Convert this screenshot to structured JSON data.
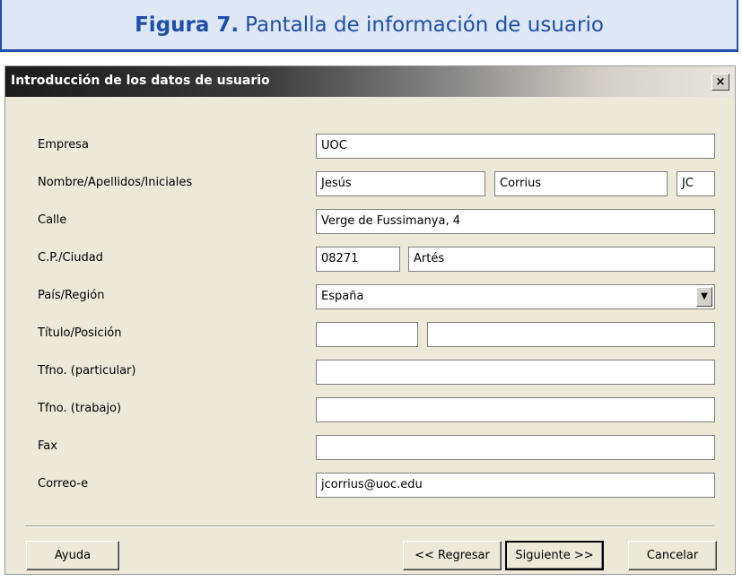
{
  "caption": {
    "number": "Figura 7.",
    "text": "Pantalla de información de usuario"
  },
  "dialog": {
    "title": "Introducción de los datos de usuario",
    "close_icon": "close-icon",
    "fields": {
      "empresa": {
        "label": "Empresa",
        "value": "UOC"
      },
      "nombre": {
        "label": "Nombre/Apellidos/Iniciales",
        "nombre": "Jesús",
        "apellidos": "Corrius",
        "iniciales": "JC"
      },
      "calle": {
        "label": "Calle",
        "value": "Verge de Fussimanya, 4"
      },
      "cp": {
        "label": "C.P./Ciudad",
        "cp": "08271",
        "ciudad": "Artés"
      },
      "pais": {
        "label": "País/Región",
        "value": "España"
      },
      "titulo": {
        "label": "Título/Posición",
        "titulo": "",
        "posicion": ""
      },
      "tfno_particular": {
        "label": "Tfno. (particular)",
        "value": ""
      },
      "tfno_trabajo": {
        "label": "Tfno. (trabajo)",
        "value": ""
      },
      "fax": {
        "label": "Fax",
        "value": ""
      },
      "correo": {
        "label": "Correo-e",
        "value": "jcorrius@uoc.edu"
      }
    },
    "buttons": {
      "ayuda": "Ayuda",
      "regresar": "<< Regresar",
      "siguiente": "Siguiente >>",
      "cancelar": "Cancelar"
    }
  }
}
